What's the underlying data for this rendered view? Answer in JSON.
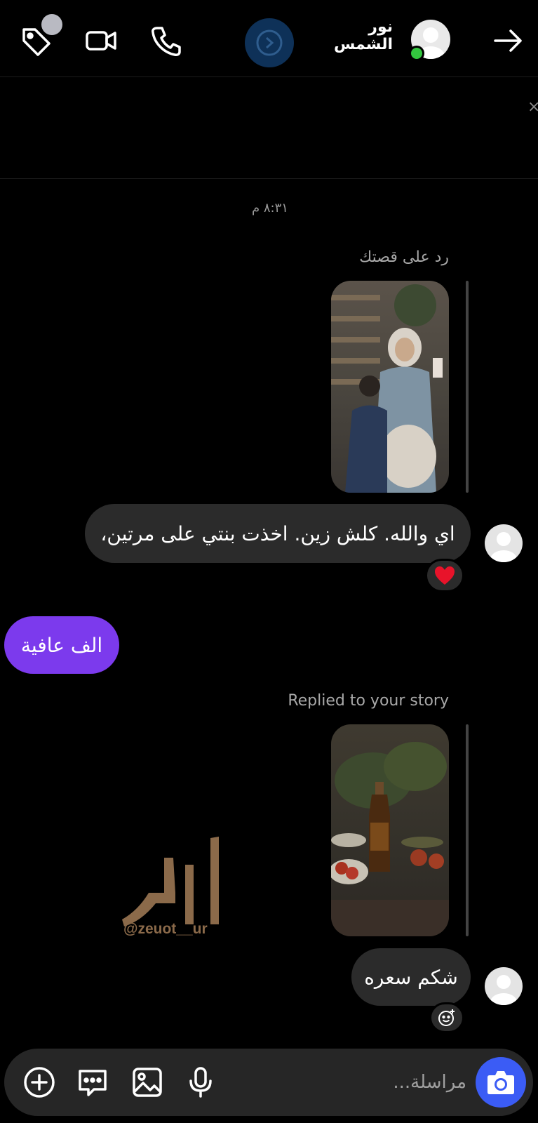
{
  "header": {
    "contact_name": "نور الشمس",
    "icons": [
      "tag-icon",
      "video-call-icon",
      "phone-icon",
      "vanish-mode-icon",
      "back-arrow-icon"
    ]
  },
  "chat": {
    "timestamp": "٨:٣١ م",
    "messages": [
      {
        "reply_label": "رد على قصتك",
        "text": "اي والله. كلش زين. اخذت بنتي على مرتين،",
        "reaction": "❤️",
        "side": "incoming"
      },
      {
        "text": "الف عافية",
        "side": "outgoing"
      },
      {
        "reply_label": "Replied to your story",
        "text": "شكم سعره",
        "reaction_icon": "add-reaction-icon",
        "side": "incoming"
      }
    ]
  },
  "watermark": {
    "handle": "@zeuot__ur"
  },
  "composer": {
    "placeholder": "مراسلة...",
    "icons": [
      "plus-icon",
      "sticker-icon",
      "gallery-icon",
      "microphone-icon",
      "camera-icon"
    ]
  },
  "colors": {
    "outgoing_bubble": "#7c3aed",
    "incoming_bubble": "#2b2b2b",
    "camera_button": "#3b5cf5",
    "online": "#33c63f"
  }
}
